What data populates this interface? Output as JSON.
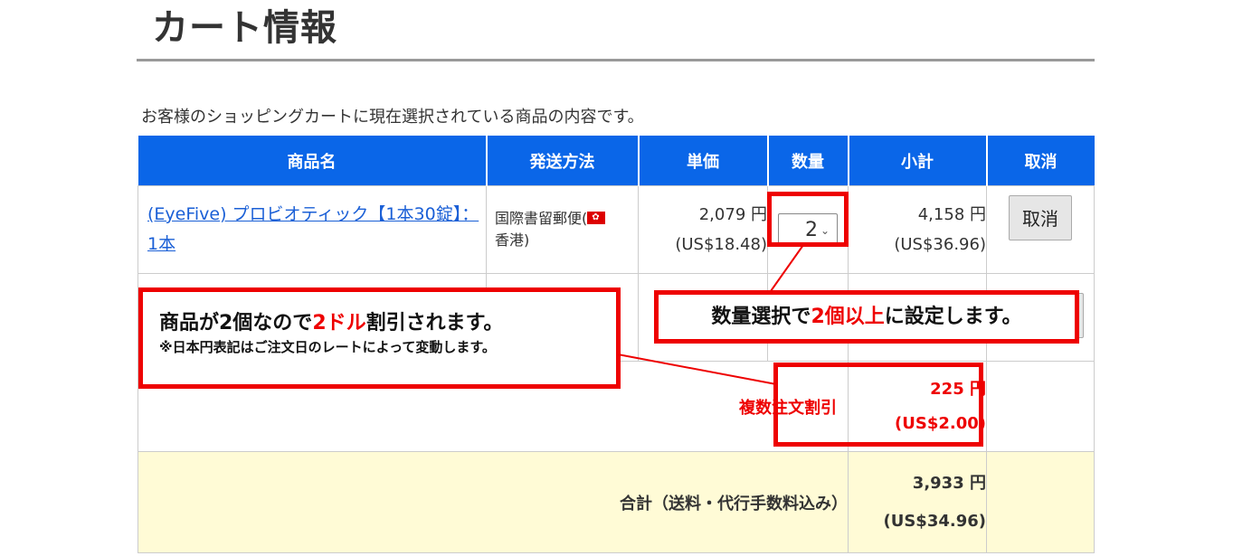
{
  "page": {
    "title": "カート情報",
    "intro": "お客様のショッピングカートに現在選択されている商品の内容です。"
  },
  "table": {
    "headers": [
      "商品名",
      "発送方法",
      "単価",
      "数量",
      "小計",
      "取消"
    ],
    "item": {
      "name": "(EyeFive) プロビオティック【1本30錠】：1本",
      "shipping": "国際書留郵便(",
      "shipping_country": "香港)",
      "unit_price_jpy": "2,079 円",
      "unit_price_usd": "(US$18.48)",
      "quantity": "2",
      "subtotal_jpy": "4,158 円",
      "subtotal_usd": "(US$36.96)",
      "cancel_label": "取消"
    },
    "discount": {
      "label": "複数注文割引",
      "amount_jpy": "225 円",
      "amount_usd": "(US$2.00)"
    },
    "total": {
      "label": "合計（送料・代行手数料込み）",
      "amount_jpy": "3,933 円",
      "amount_usd": "(US$34.96)"
    }
  },
  "callouts": {
    "discount": {
      "line1_a": "商品が2個なので",
      "line1_red": "2ドル",
      "line1_b": "割引されます。",
      "line2": "※日本円表記はご注文日のレートによって変動します。"
    },
    "quantity": {
      "a": "数量選択で",
      "red": "2個以上",
      "b": "に設定します。"
    }
  },
  "colors": {
    "header_bg": "#0a66e8",
    "accent_red": "#e00000",
    "total_bg": "#fffbd6",
    "link": "#1a5fd6"
  },
  "icons": [
    "hong-kong-flag-icon",
    "chevron-down-icon"
  ]
}
